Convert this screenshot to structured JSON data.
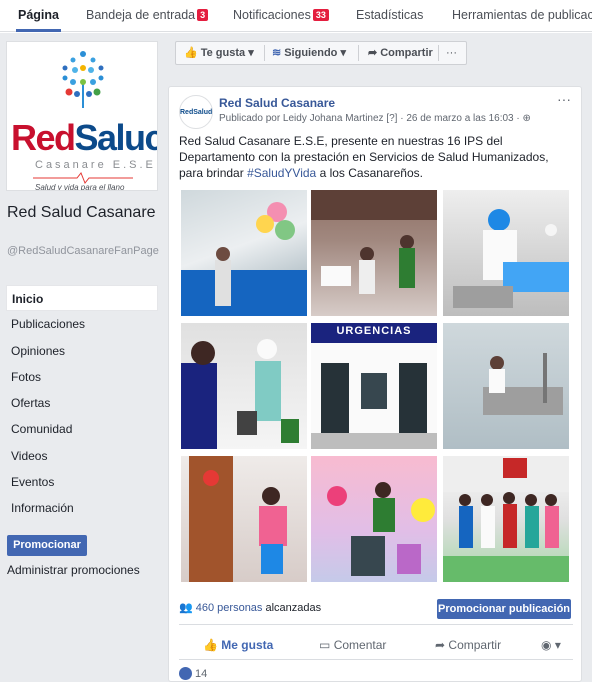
{
  "tabs": [
    {
      "label": "Página"
    },
    {
      "label": "Bandeja de entrada",
      "badge": "3"
    },
    {
      "label": "Notificaciones",
      "badge": "33"
    },
    {
      "label": "Estadísticas"
    },
    {
      "label": "Herramientas de publicació"
    }
  ],
  "page": {
    "logo_word_red": "Red",
    "logo_word_blue": "Saluc",
    "logo_sub": "Casanare E.S.E",
    "logo_slogan": "Salud y vida para el llano",
    "name": "Red Salud Casanare",
    "handle": "@RedSaludCasanareFanPage"
  },
  "nav": [
    "Inicio",
    "Publicaciones",
    "Opiniones",
    "Fotos",
    "Ofertas",
    "Comunidad",
    "Videos",
    "Eventos",
    "Información"
  ],
  "promote_label": "Promocionar",
  "admin_label": "Administrar promociones",
  "actionbar": {
    "like": "Te gusta",
    "follow": "Siguiendo",
    "share": "Compartir",
    "more": "···"
  },
  "post": {
    "avatar_text": "RedSalud",
    "author": "Red Salud Casanare",
    "meta": "Publicado por Leidy Johana Martinez [?] · 26 de marzo a las 16:03 ·",
    "menu": "···",
    "text_main": "Red Salud Casanare E.S.E, presente en nuestras 16 IPS del Departamento con la prestación en Servicios de Salud Humanizados, para brindar",
    "hashtag": "#SaludYVida",
    "text_end": " a los Casanareños.",
    "photo_sign": "URGENCIAS",
    "reach_count": "460 personas",
    "reach_label": " alcanzadas",
    "boost_label": "Promocionar publicación",
    "like_label": "Me gusta",
    "comment_label": "Comentar",
    "share_label": "Compartir",
    "likes_count": "14"
  },
  "colors": {
    "accent": "#4267b2",
    "link": "#385898",
    "badge": "#e41e3f",
    "brand_red": "#c8102e",
    "brand_blue": "#0c4a8a"
  }
}
